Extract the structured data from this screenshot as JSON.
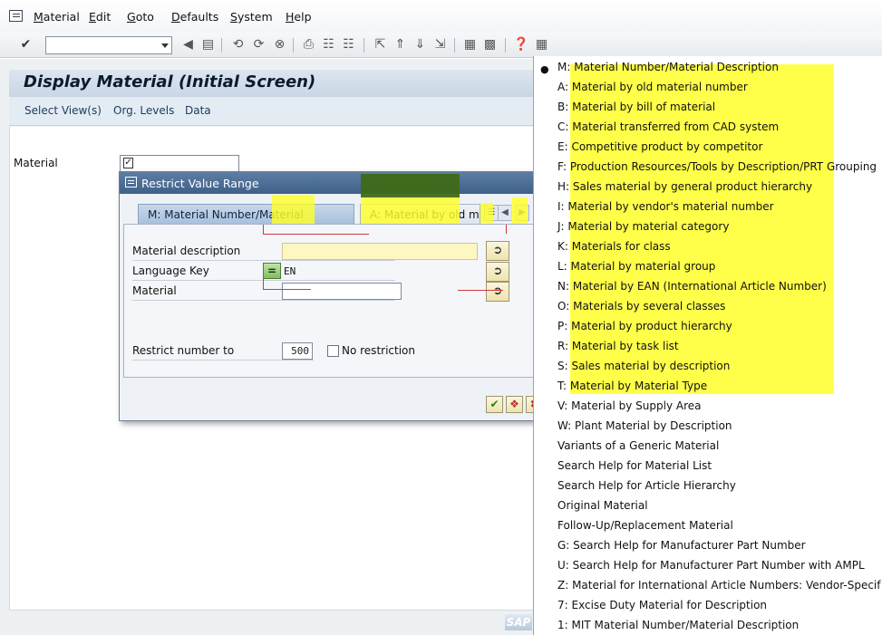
{
  "menubar": {
    "items": [
      "Material",
      "Edit",
      "Goto",
      "Defaults",
      "System",
      "Help"
    ]
  },
  "toolbar": {
    "command_field_value": ""
  },
  "screen": {
    "title": "Display Material (Initial Screen)",
    "app_toolbar": [
      "Select View(s)",
      "Org. Levels",
      "Data"
    ],
    "material_label": "Material",
    "material_value": ""
  },
  "dialog": {
    "title": "Restrict Value Range",
    "tabs": [
      "M: Material Number/Material Description",
      "A: Material by old m..."
    ],
    "fields": {
      "material_description_label": "Material description",
      "material_description_value": "",
      "language_key_label": "Language Key",
      "language_key_value": "EN",
      "material_label": "Material",
      "material_value": "",
      "restrict_label": "Restrict number to",
      "restrict_value": "500",
      "no_restriction_label": "No restriction"
    }
  },
  "dropdown": {
    "selected_index": 0,
    "items": [
      "M: Material Number/Material Description",
      "A: Material by old material number",
      "B: Material by bill of material",
      "C: Material transferred from CAD system",
      "E: Competitive product by competitor",
      "F: Production Resources/Tools by Description/PRT Grouping",
      "H: Sales material by general product hierarchy",
      "I: Material by vendor's material number",
      "J: Material by material category",
      "K: Materials for class",
      "L: Material by material group",
      "N: Material by EAN (International Article Number)",
      "O: Materials by several classes",
      "P: Material by product hierarchy",
      "R: Material by task list",
      "S: Sales material by description",
      "T: Material by Material Type",
      "V: Material by Supply Area",
      "W: Plant Material by Description",
      "Variants of a Generic Material",
      "Search Help for Material List",
      "Search Help for Article Hierarchy",
      "Original Material",
      "Follow-Up/Replacement Material",
      "G: Search Help for Manufacturer Part Number",
      "U: Search Help for Manufacturer Part Number with AMPL",
      "Z: Material for International Article Numbers: Vendor-Specif",
      "7: Excise Duty Material for Description",
      "1: MIT Material Number/Material Description"
    ]
  },
  "colors": {
    "highlight": "#ffff2a",
    "dialog_title": "#3f6189",
    "tab_active": "#a8c0dc"
  }
}
